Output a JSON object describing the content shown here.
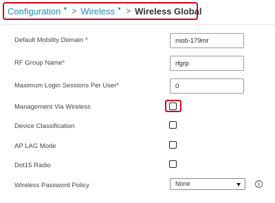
{
  "breadcrumb": {
    "items": [
      "Configuration",
      "Wireless"
    ],
    "current": "Wireless Global"
  },
  "form": {
    "default_mobility_domain": {
      "label": "Default Mobility Domain *",
      "value": "mob-179mr"
    },
    "rf_group_name": {
      "label": "RF Group Name*",
      "value": "rfgrp"
    },
    "max_login_sessions": {
      "label": "Maximum Login Sessions Per User*",
      "value": "0"
    },
    "management_via_wireless": {
      "label": "Management Via Wireless",
      "checked": false
    },
    "device_classification": {
      "label": "Device Classification",
      "checked": false
    },
    "ap_lag_mode": {
      "label": "AP LAG Mode",
      "checked": false
    },
    "dot15_radio": {
      "label": "Dot15 Radio",
      "checked": false
    },
    "wireless_password_policy": {
      "label": "Wireless Password Policy",
      "selected": "None"
    }
  },
  "icons": {
    "info": "info-icon",
    "dropdown": "chevron-down-icon"
  },
  "colors": {
    "link": "#1a8bbf",
    "highlight": "#d0021b"
  }
}
